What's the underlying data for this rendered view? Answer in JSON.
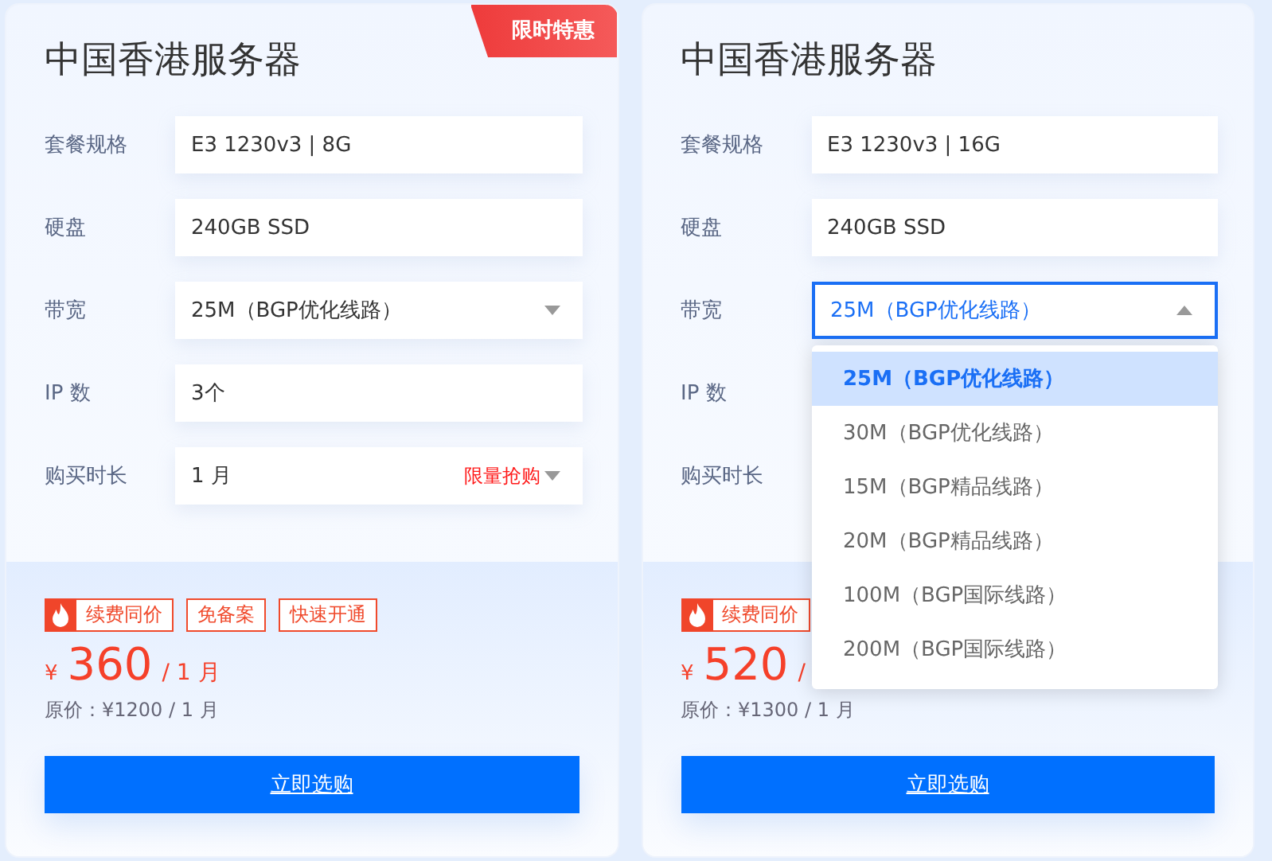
{
  "cards": [
    {
      "title": "中国香港服务器",
      "badge": "限时特惠",
      "fields": [
        {
          "label": "套餐规格",
          "kind": "text",
          "value": "E3 1230v3 | 8G"
        },
        {
          "label": "硬盘",
          "kind": "text",
          "value": "240GB SSD"
        },
        {
          "label": "带宽",
          "kind": "select",
          "value": "25M（BGP优化线路）",
          "open": false
        },
        {
          "label": "IP 数",
          "kind": "text",
          "value": "3个"
        },
        {
          "label": "购买时长",
          "kind": "select",
          "value": "1 月",
          "promo": "限量抢购",
          "open": false
        }
      ],
      "tags": [
        {
          "label": "续费同价",
          "hot": true
        },
        {
          "label": "免备案",
          "hot": false
        },
        {
          "label": "快速开通",
          "hot": false
        }
      ],
      "currency": "¥",
      "price": "360",
      "unit": "/ 1 月",
      "original": "原价：¥1200 / 1 月",
      "button": "立即选购"
    },
    {
      "title": "中国香港服务器",
      "fields": [
        {
          "label": "套餐规格",
          "kind": "text",
          "value": "E3 1230v3 | 16G"
        },
        {
          "label": "硬盘",
          "kind": "text",
          "value": "240GB SSD"
        },
        {
          "label": "带宽",
          "kind": "select",
          "value": "25M（BGP优化线路）",
          "open": true,
          "options": [
            {
              "label": "25M（BGP优化线路）",
              "selected": true
            },
            {
              "label": "30M（BGP优化线路）",
              "selected": false
            },
            {
              "label": "15M（BGP精品线路）",
              "selected": false
            },
            {
              "label": "20M（BGP精品线路）",
              "selected": false
            },
            {
              "label": "100M（BGP国际线路）",
              "selected": false
            },
            {
              "label": "200M（BGP国际线路）",
              "selected": false
            }
          ]
        },
        {
          "label": "IP 数",
          "kind": "hidden"
        },
        {
          "label": "购买时长",
          "kind": "hidden"
        }
      ],
      "tags": [
        {
          "label": "续费同价",
          "hot": true
        }
      ],
      "currency": "¥",
      "price": "520",
      "unit": "/",
      "original": "原价：¥1300 / 1 月",
      "button": "立即选购"
    }
  ]
}
